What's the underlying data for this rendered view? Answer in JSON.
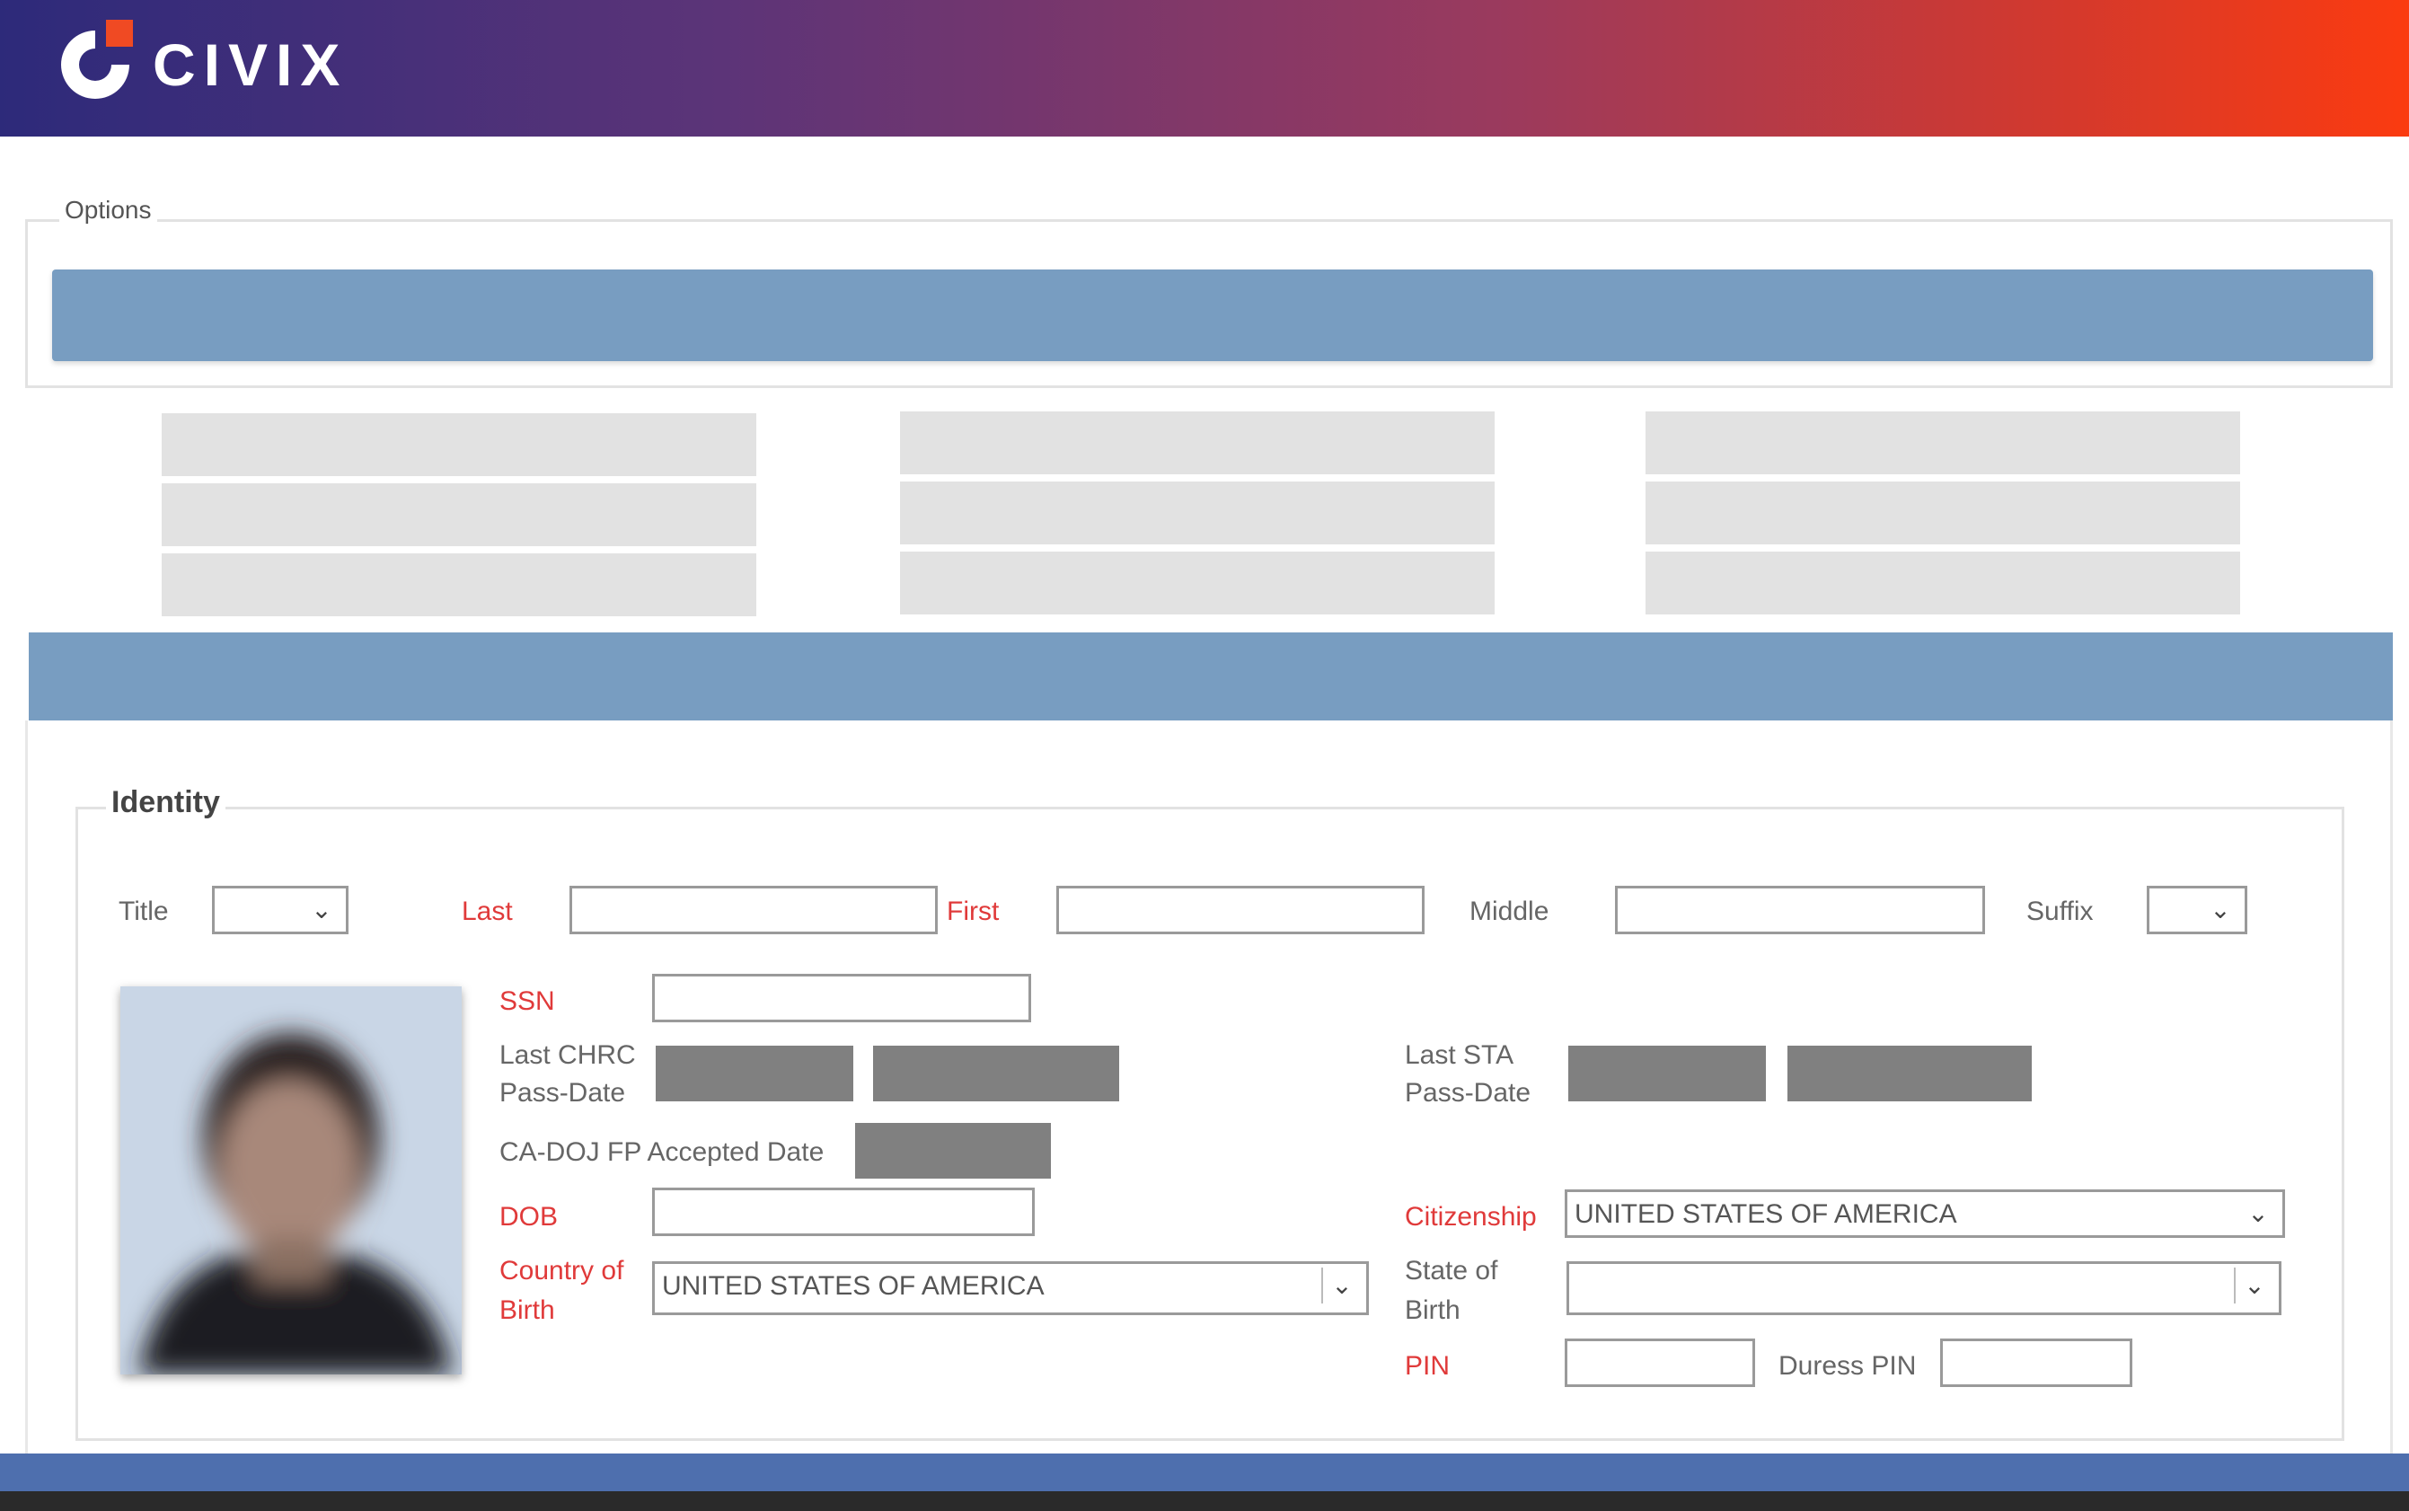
{
  "app": {
    "brand": "CIVIX"
  },
  "colors": {
    "accent_bar": "#789dc1",
    "required_label": "#e03a3a",
    "footer": "#4e6fae",
    "redacted": "#808080"
  },
  "options": {
    "legend": "Options"
  },
  "identity": {
    "legend": "Identity",
    "title_label": "Title",
    "title_value": "",
    "last_label": "Last",
    "last_value": "",
    "first_label": "First",
    "first_value": "",
    "middle_label": "Middle",
    "middle_value": "",
    "suffix_label": "Suffix",
    "suffix_value": "",
    "ssn_label": "SSN",
    "ssn_value": "",
    "last_chrc_label_1": "Last CHRC",
    "last_chrc_label_2": "Pass-Date",
    "last_sta_label_1": "Last STA",
    "last_sta_label_2": "Pass-Date",
    "cadoj_label": "CA-DOJ FP Accepted Date",
    "dob_label": "DOB",
    "dob_value": "",
    "citizenship_label": "Citizenship",
    "citizenship_value": "UNITED STATES OF AMERICA",
    "country_birth_label_1": "Country of",
    "country_birth_label_2": "Birth",
    "country_birth_value": "UNITED STATES OF AMERICA",
    "state_birth_label_1": "State of",
    "state_birth_label_2": "Birth",
    "state_birth_value": "",
    "pin_label": "PIN",
    "pin_value": "",
    "duress_pin_label": "Duress PIN",
    "duress_pin_value": ""
  },
  "icons": {
    "dropdown": "chevron-down-icon",
    "photo": "person-photo"
  }
}
